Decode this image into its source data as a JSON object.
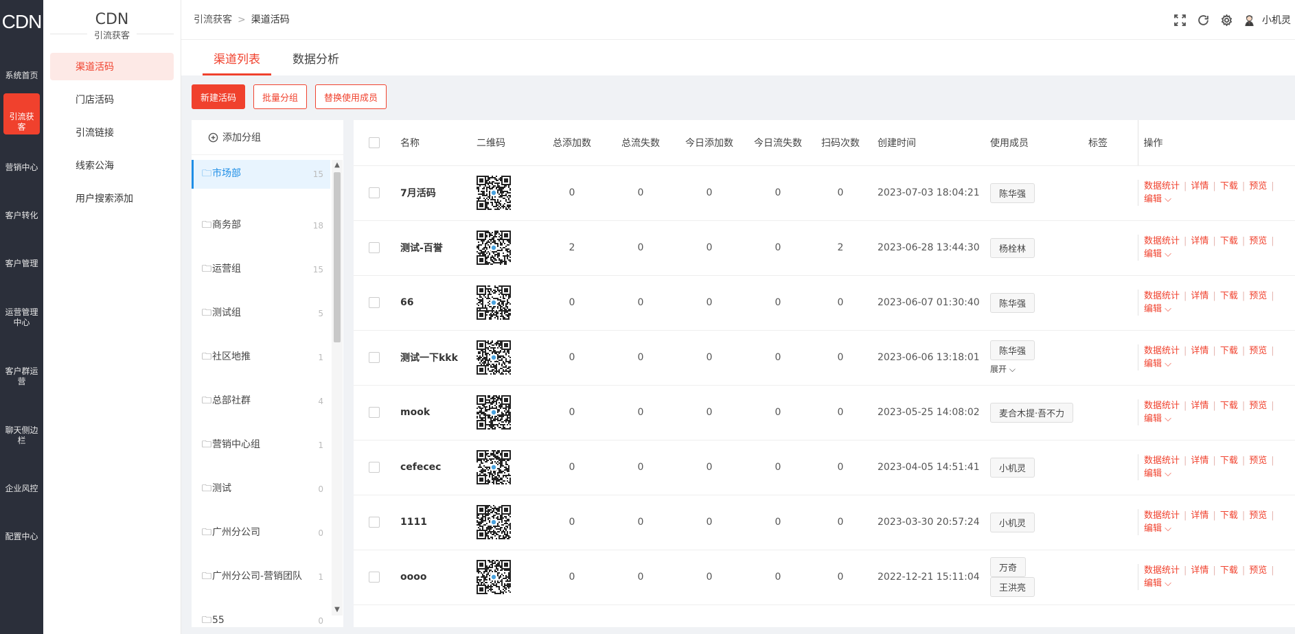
{
  "rail": {
    "logo": "CDN",
    "items": [
      {
        "label": "系统首页",
        "icon": "home-icon"
      },
      {
        "label": "引流获客",
        "icon": "chart-icon",
        "active": true
      },
      {
        "label": "营销中心",
        "icon": "calendar-icon"
      },
      {
        "label": "客户转化",
        "icon": "pie-icon"
      },
      {
        "label": "客户管理",
        "icon": "doc-icon"
      },
      {
        "label": "运营管理中心",
        "icon": "trend-icon"
      },
      {
        "label": "客户群运营",
        "icon": "users-icon"
      },
      {
        "label": "聊天侧边栏",
        "icon": "chat-icon"
      },
      {
        "label": "企业风控",
        "icon": "shield-icon"
      },
      {
        "label": "配置中心",
        "icon": "wrench-icon"
      }
    ]
  },
  "subnav": {
    "title": "CDN",
    "section": "引流获客",
    "items": [
      "渠道活码",
      "门店活码",
      "引流链接",
      "线索公海",
      "用户搜索添加"
    ]
  },
  "header": {
    "breadcrumb": [
      "引流获客",
      "渠道活码"
    ],
    "username": "小机灵"
  },
  "tabs": [
    "渠道列表",
    "数据分析"
  ],
  "toolbar": {
    "new_label": "新建活码",
    "batch_group_label": "批量分组",
    "replace_member_label": "替换使用成员"
  },
  "groups": {
    "add_label": "添加分组",
    "items": [
      {
        "name": "市场部",
        "count": "15"
      },
      {
        "name": "商务部",
        "count": "18"
      },
      {
        "name": "运营组",
        "count": "15"
      },
      {
        "name": "测试组",
        "count": "5"
      },
      {
        "name": "社区地推",
        "count": "1"
      },
      {
        "name": "总部社群",
        "count": "4"
      },
      {
        "name": "营销中心组",
        "count": "1"
      },
      {
        "name": "测试",
        "count": "0"
      },
      {
        "name": "广州分公司",
        "count": "0"
      },
      {
        "name": "广州分公司-营销团队",
        "count": "1"
      },
      {
        "name": "55",
        "count": "0"
      }
    ]
  },
  "table": {
    "columns": [
      "名称",
      "二维码",
      "总添加数",
      "总流失数",
      "今日添加数",
      "今日流失数",
      "扫码次数",
      "创建时间",
      "使用成员",
      "标签",
      "操作"
    ],
    "ops": [
      "数据统计",
      "详情",
      "下载",
      "预览",
      "编辑"
    ],
    "expand_label": "展开",
    "rows": [
      {
        "name": "7月活码",
        "total_add": "0",
        "total_lost": "0",
        "today_add": "0",
        "today_lost": "0",
        "scans": "0",
        "created": "2023-07-03 18:04:21",
        "members": [
          "陈华强"
        ]
      },
      {
        "name": "测试-百誉",
        "total_add": "2",
        "total_lost": "0",
        "today_add": "0",
        "today_lost": "0",
        "scans": "2",
        "created": "2023-06-28 13:44:30",
        "members": [
          "杨栓林"
        ]
      },
      {
        "name": "66",
        "total_add": "0",
        "total_lost": "0",
        "today_add": "0",
        "today_lost": "0",
        "scans": "0",
        "created": "2023-06-07 01:30:40",
        "members": [
          "陈华强"
        ]
      },
      {
        "name": "测试一下kkk",
        "total_add": "0",
        "total_lost": "0",
        "today_add": "0",
        "today_lost": "0",
        "scans": "0",
        "created": "2023-06-06 13:18:01",
        "members": [
          "陈华强"
        ],
        "expand": true
      },
      {
        "name": "mook",
        "total_add": "0",
        "total_lost": "0",
        "today_add": "0",
        "today_lost": "0",
        "scans": "0",
        "created": "2023-05-25 14:08:02",
        "members": [
          "麦合木提·吾不力"
        ]
      },
      {
        "name": "cefecec",
        "total_add": "0",
        "total_lost": "0",
        "today_add": "0",
        "today_lost": "0",
        "scans": "0",
        "created": "2023-04-05 14:51:41",
        "members": [
          "小机灵"
        ]
      },
      {
        "name": "1111",
        "total_add": "0",
        "total_lost": "0",
        "today_add": "0",
        "today_lost": "0",
        "scans": "0",
        "created": "2023-03-30 20:57:24",
        "members": [
          "小机灵"
        ]
      },
      {
        "name": "oooo",
        "total_add": "0",
        "total_lost": "0",
        "today_add": "0",
        "today_lost": "0",
        "scans": "0",
        "created": "2022-12-21 15:11:04",
        "members": [
          "万奇",
          "王洪亮"
        ]
      }
    ]
  },
  "colors": {
    "accent": "#f0412d",
    "rail": "#2b2f3a",
    "link_blue": "#1e8ee6"
  }
}
